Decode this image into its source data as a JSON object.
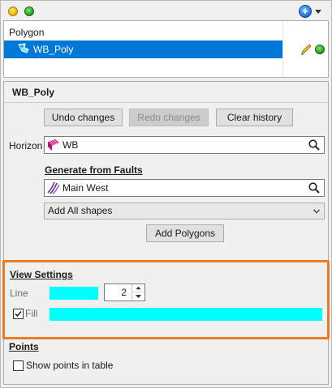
{
  "toolbar": {
    "icons": [
      "yellow-dot-icon",
      "green-dot-icon",
      "add-icon",
      "chevron-down-icon"
    ]
  },
  "tree": {
    "root_label": "Polygon",
    "item_label": "WB_Poly",
    "item_selected": true
  },
  "properties": {
    "title": "WB_Poly",
    "undo_label": "Undo changes",
    "redo_label": "Redo changes",
    "clear_label": "Clear history",
    "horizon_label": "Horizon",
    "horizon_value": "WB",
    "generate_title": "Generate from Faults",
    "fault_value": "Main West",
    "shapes_selected": "Add All shapes",
    "add_polygons_label": "Add Polygons"
  },
  "view_settings": {
    "title": "View Settings",
    "line_label": "Line",
    "line_color": "#00ffff",
    "line_width": "2",
    "fill_label": "Fill",
    "fill_checked": true,
    "fill_color": "#00ffff"
  },
  "points": {
    "title": "Points",
    "show_points_label": "Show points in table",
    "show_points_checked": false
  },
  "colors": {
    "selection": "#0078d7",
    "highlight_border": "#ef7b21",
    "swatch": "#00ffff"
  }
}
